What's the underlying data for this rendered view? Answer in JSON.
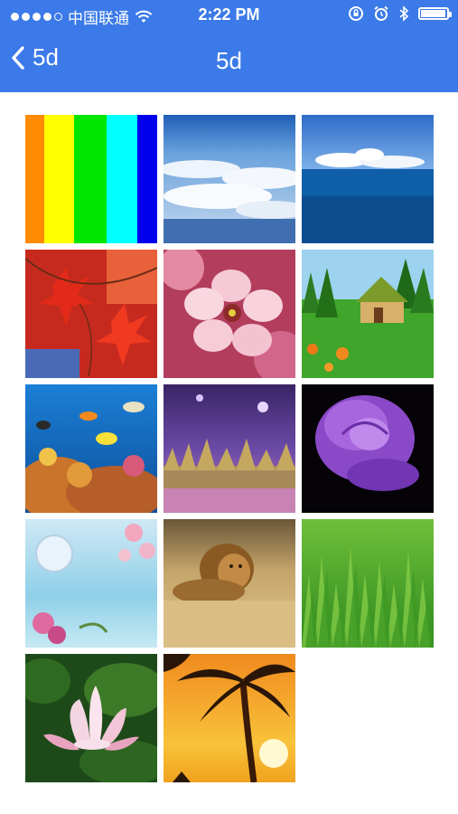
{
  "status": {
    "carrier": "中国联通",
    "time": "2:22 PM",
    "battery_level": 0.95
  },
  "nav": {
    "back_label": "5d",
    "title": "5d"
  },
  "wallpapers": [
    {
      "name": "rainbow-stripes"
    },
    {
      "name": "clouds-from-above"
    },
    {
      "name": "sea-and-sky"
    },
    {
      "name": "red-maple-leaves"
    },
    {
      "name": "pink-blossom"
    },
    {
      "name": "cottage-on-meadow"
    },
    {
      "name": "coral-reef-fish"
    },
    {
      "name": "purple-grass-field"
    },
    {
      "name": "purple-rose"
    },
    {
      "name": "moon-and-blossoms"
    },
    {
      "name": "lion-in-grass"
    },
    {
      "name": "green-grass"
    },
    {
      "name": "lotus-flower"
    },
    {
      "name": "palm-tree-sunset"
    }
  ]
}
